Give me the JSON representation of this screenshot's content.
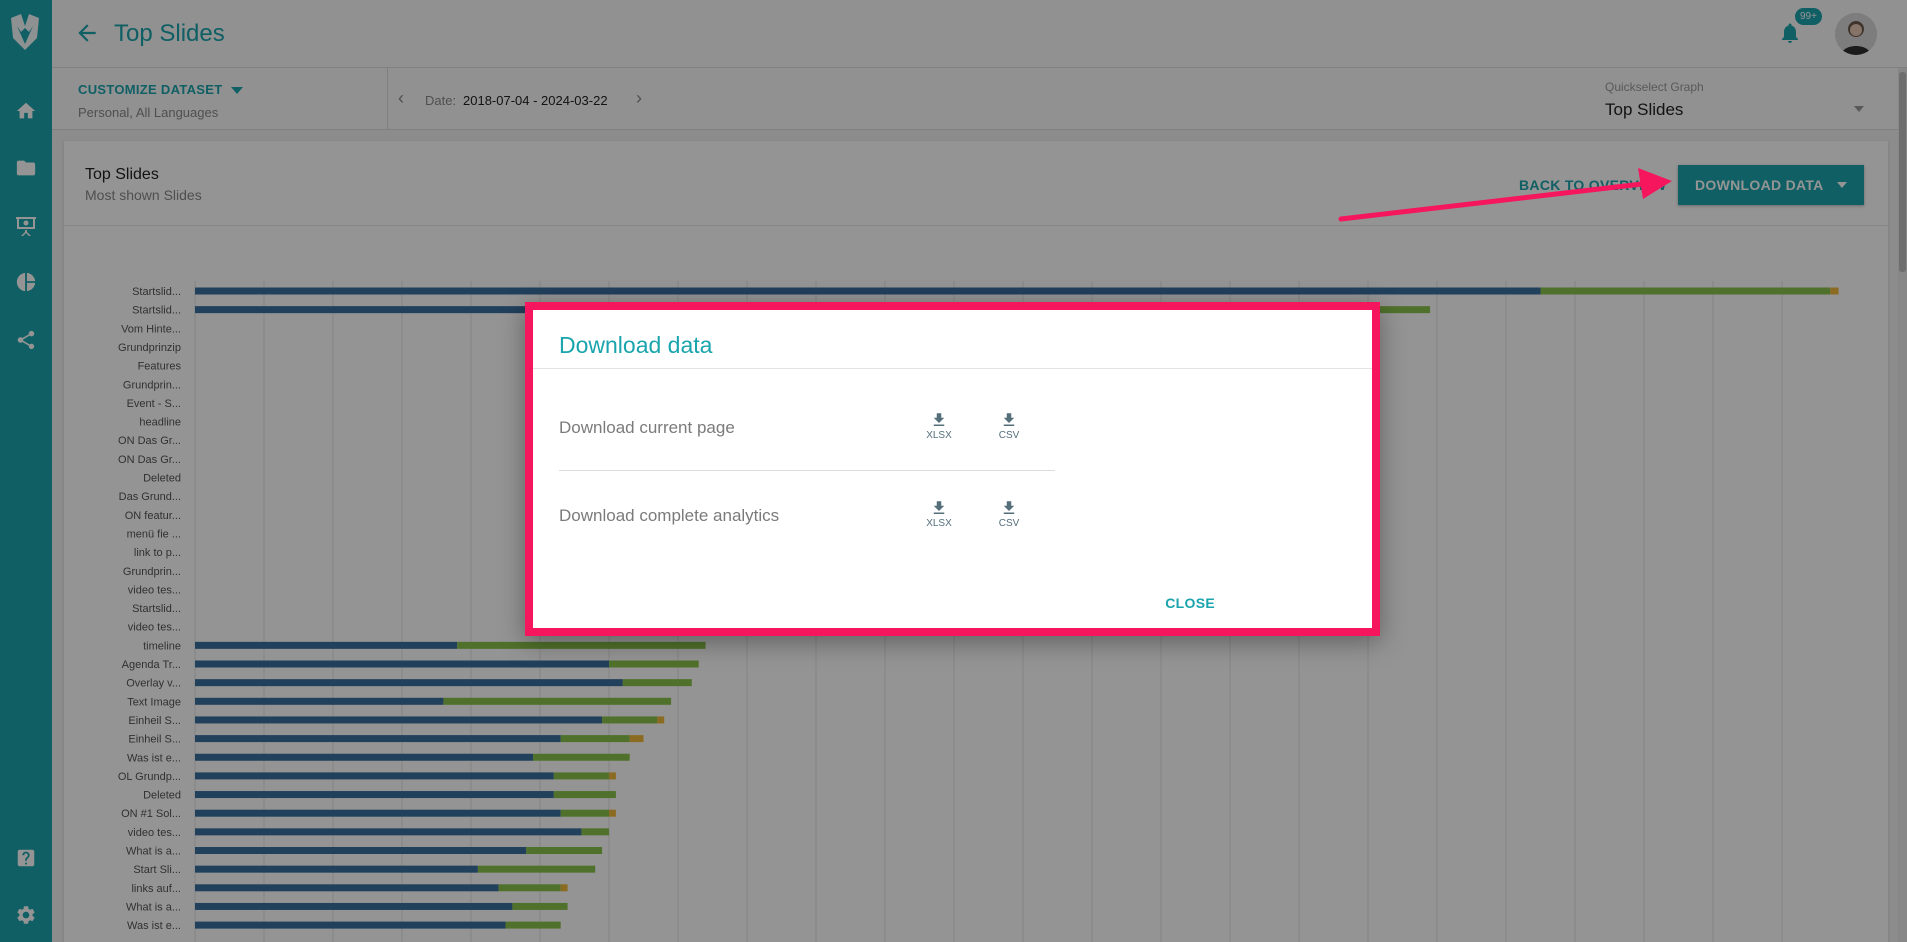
{
  "header": {
    "title": "Top Slides",
    "notification_badge": "99+"
  },
  "filters": {
    "customize_label": "CUSTOMIZE DATASET",
    "dataset_summary": "Personal, All Languages",
    "date_label": "Date:",
    "date_range": "2018-07-04 - 2024-03-22",
    "quickselect_label": "Quickselect Graph",
    "quickselect_value": "Top Slides"
  },
  "card": {
    "title": "Top Slides",
    "subtitle": "Most shown Slides",
    "back_label": "BACK TO OVERVIEW",
    "download_label": "DOWNLOAD DATA"
  },
  "colors": {
    "accent": "#1aa4ad",
    "highlight": "#f5165e",
    "bar_blue": "#3a6f9f",
    "bar_green": "#8bc34a",
    "bar_orange": "#f0b93b"
  },
  "icons": {
    "sidebar": [
      "logo-icon",
      "home-icon",
      "folder-icon",
      "presentation-icon",
      "pie-chart-icon",
      "share-icon",
      "help-icon",
      "settings-icon"
    ],
    "header": [
      "back-arrow-icon",
      "bell-icon"
    ]
  },
  "modal": {
    "title": "Download data",
    "rows": [
      {
        "label": "Download current page",
        "formats": [
          "XLSX",
          "CSV"
        ]
      },
      {
        "label": "Download complete analytics",
        "formats": [
          "XLSX",
          "CSV"
        ]
      }
    ],
    "close_label": "CLOSE"
  },
  "chart_data": {
    "type": "bar",
    "orientation": "horizontal",
    "stacked": true,
    "categories": [
      "Startslid...",
      "Startslid...",
      "Vom Hinte...",
      "Grundprinzip",
      "Features",
      "Grundprin...",
      "Event - S...",
      "headline",
      "ON Das Gr...",
      "ON Das Gr...",
      "Deleted",
      "Das Grund...",
      "ON featur...",
      "menü fie ...",
      "link to p...",
      "Grundprin...",
      "video tes...",
      "Startslid...",
      "video tes...",
      "timeline",
      "Agenda Tr...",
      "Overlay v...",
      "Text Image",
      "Einheil S...",
      "Einheil S...",
      "Was ist e...",
      "OL Grundp...",
      "Deleted",
      "ON #1 Sol...",
      "video tes...",
      "What is a...",
      "Start Sli...",
      "links auf...",
      "What is a...",
      "Was ist e..."
    ],
    "series": [
      {
        "values": [
          195,
          145,
          null,
          null,
          null,
          null,
          null,
          null,
          null,
          null,
          null,
          null,
          null,
          null,
          null,
          null,
          null,
          null,
          null,
          38,
          60,
          62,
          36,
          59,
          53,
          49,
          52,
          52,
          53,
          56,
          48,
          41,
          44,
          46,
          45
        ]
      },
      {
        "values": [
          42,
          34,
          null,
          null,
          null,
          null,
          null,
          null,
          null,
          null,
          null,
          null,
          null,
          null,
          null,
          null,
          null,
          null,
          null,
          36,
          13,
          10,
          33,
          8,
          10,
          14,
          8,
          9,
          7,
          4,
          11,
          17,
          9,
          8,
          8
        ]
      },
      {
        "values": [
          1.2,
          0,
          null,
          null,
          null,
          null,
          null,
          null,
          null,
          null,
          null,
          null,
          null,
          null,
          null,
          null,
          null,
          null,
          null,
          0,
          0,
          0,
          0,
          1,
          2,
          0,
          1,
          0,
          1,
          0,
          0,
          0,
          1,
          0,
          0
        ]
      }
    ]
  }
}
